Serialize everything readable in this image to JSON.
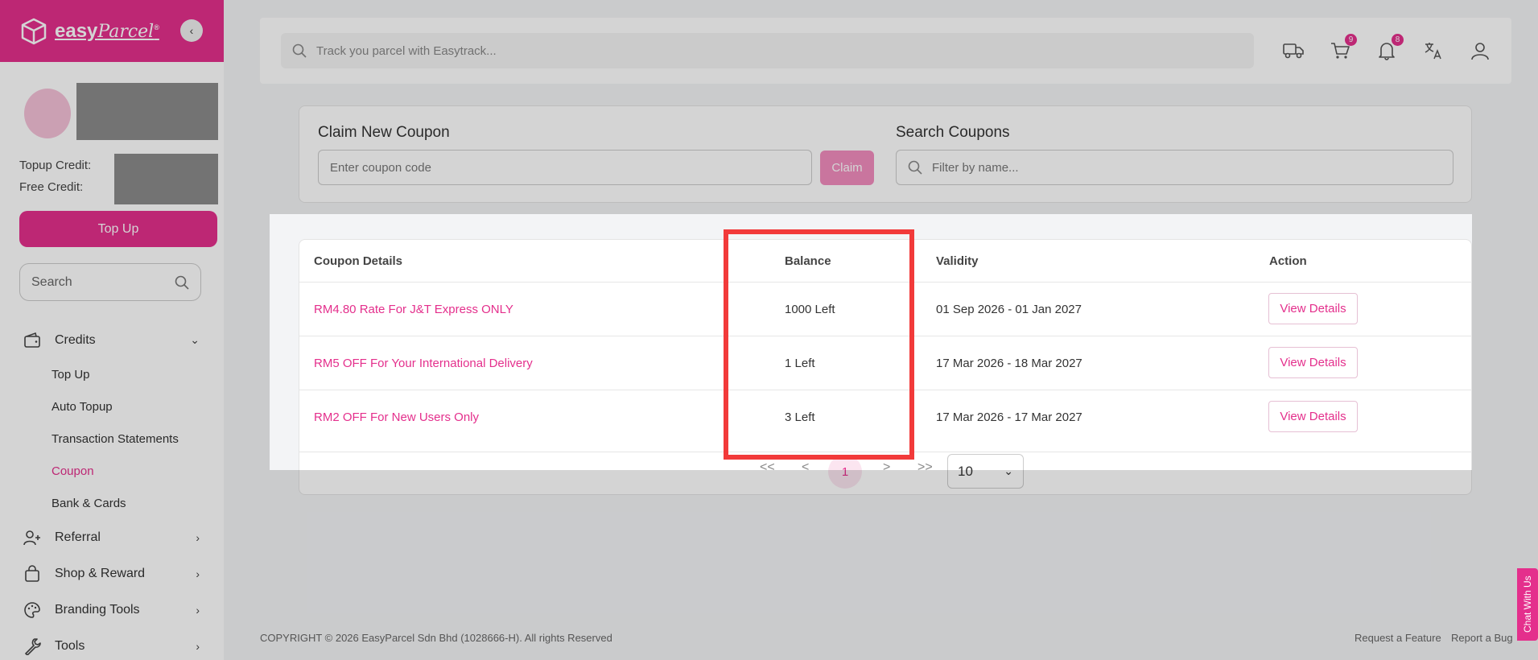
{
  "brand": {
    "name": "easy",
    "name_script": "Parcel",
    "reg": "®"
  },
  "profile": {
    "topup_credit_label": "Topup Credit:",
    "free_credit_label": "Free Credit:",
    "topup_button": "Top Up"
  },
  "sidebar": {
    "search_placeholder": "Search",
    "items": [
      {
        "label": "Credits",
        "icon": "wallet-icon",
        "expanded": true
      },
      {
        "label": "Referral",
        "icon": "user-plus-icon"
      },
      {
        "label": "Shop & Reward",
        "icon": "shopping-bag-icon"
      },
      {
        "label": "Branding Tools",
        "icon": "palette-icon"
      },
      {
        "label": "Tools",
        "icon": "wrench-icon"
      }
    ],
    "credits_sub": [
      "Top Up",
      "Auto Topup",
      "Transaction Statements",
      "Coupon",
      "Bank & Cards"
    ],
    "active_sub": "Coupon"
  },
  "topbar": {
    "track_placeholder": "Track you parcel with Easytrack...",
    "cart_count": "9",
    "notif_count": "8"
  },
  "claim": {
    "title": "Claim New Coupon",
    "input_placeholder": "Enter coupon code",
    "button": "Claim"
  },
  "search": {
    "title": "Search Coupons",
    "placeholder": "Filter by name..."
  },
  "table": {
    "headers": [
      "Coupon Details",
      "Balance",
      "Validity",
      "Action"
    ],
    "rows": [
      {
        "name": "RM4.80 Rate For J&T Express ONLY",
        "balance": "1000 Left",
        "validity": "01 Sep 2026 - 01 Jan 2027",
        "action": "View Details"
      },
      {
        "name": "RM5 OFF For Your International Delivery",
        "balance": "1 Left",
        "validity": "17 Mar 2026 - 18 Mar 2027",
        "action": "View Details"
      },
      {
        "name": "RM2 OFF For New Users Only",
        "balance": "3 Left",
        "validity": "17 Mar 2026 - 17 Mar 2027",
        "action": "View Details"
      }
    ]
  },
  "pagination": {
    "first": "<<",
    "prev": "<",
    "current": "1",
    "next": ">",
    "last": ">>",
    "per_page": "10"
  },
  "footer": {
    "copyright": "COPYRIGHT © 2026 EasyParcel Sdn Bhd (1028666-H). All rights Reserved",
    "request_feature": "Request a Feature",
    "report_bug": "Report a Bug"
  },
  "chat": "Chat With Us",
  "colors": {
    "brand": "#e42f8c",
    "highlight": "#f23a3a"
  }
}
